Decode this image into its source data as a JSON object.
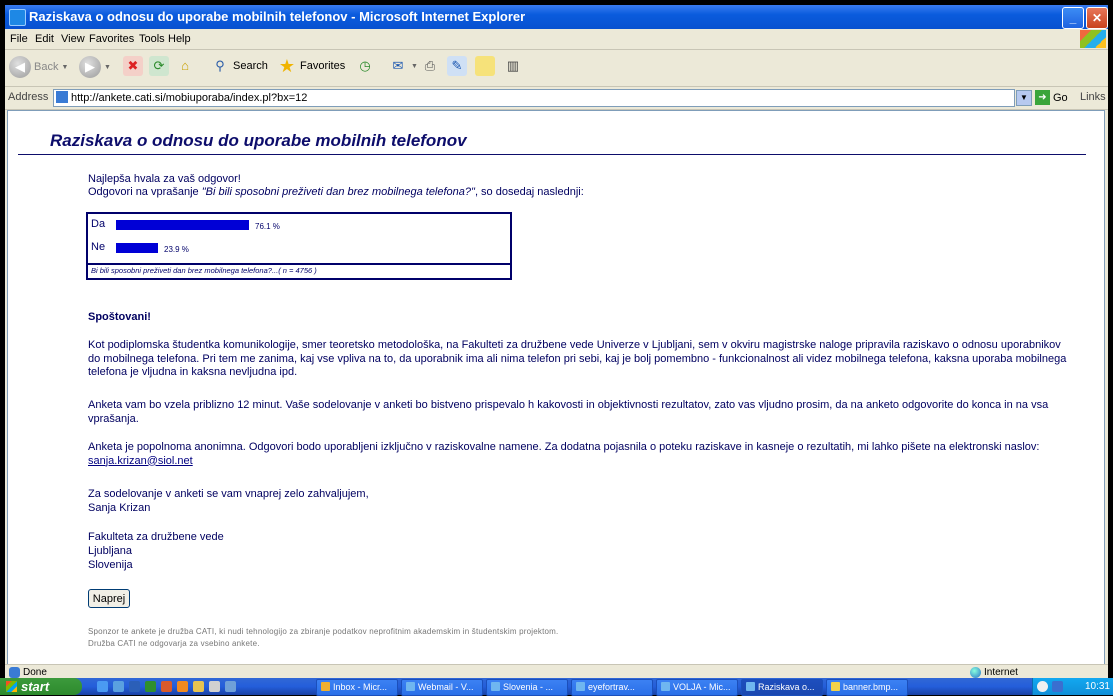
{
  "window": {
    "title": "Raziskava o odnosu do uporabe mobilnih telefonov - Microsoft Internet Explorer"
  },
  "menu": [
    "File",
    "Edit",
    "View",
    "Favorites",
    "Tools",
    "Help"
  ],
  "toolbar": {
    "back": "Back",
    "search": "Search",
    "favorites": "Favorites"
  },
  "address": {
    "label": "Address",
    "url": "http://ankete.cati.si/mobiuporaba/index.pl?bx=12",
    "go": "Go",
    "links": "Links"
  },
  "page": {
    "title": "Raziskava o odnosu do uporabe mobilnih telefonov",
    "thanks": "Najlepša hvala za vaš odgovor!",
    "answers_prefix": "Odgovori na vprašanje ",
    "question": "\"Bi bili sposobni preživeti dan brez mobilnega telefona?\"",
    "answers_suffix": ", so dosedaj naslednji:",
    "poll": [
      {
        "label": "Da",
        "value": 76.1,
        "pct_text": "76.1 %"
      },
      {
        "label": "Ne",
        "value": 23.9,
        "pct_text": "23.9 %"
      }
    ],
    "poll_footer": "Bi bili sposobni preživeti dan brez mobilnega telefona?...( n = 4756 )",
    "greeting": "Spoštovani!",
    "para1": "Kot podiplomska študentka komunikologije, smer teoretsko metodološka, na Fakulteti za družbene vede Univerze v Ljubljani, sem v okviru magistrske naloge pripravila raziskavo o odnosu uporabnikov do mobilnega telefona. Pri tem me zanima, kaj vse vpliva na to, da uporabnik ima ali nima telefon pri sebi, kaj je bolj pomembno - funkcionalnost ali videz mobilnega telefona, kaksna uporaba mobilnega telefona je vljudna in kaksna nevljudna ipd.",
    "para2": "Anketa vam bo vzela priblizno 12 minut. Vaše sodelovanje v anketi bo bistveno prispevalo h kakovosti in objektivnosti rezultatov, zato vas vljudno prosim, da na anketo odgovorite do konca in na vsa vprašanja.",
    "para3": "Anketa je popolnoma anonimna. Odgovori bodo uporabljeni izključno v raziskovalne namene. Za dodatna pojasnila o poteku raziskave in kasneje o rezultatih, mi lahko pišete na elektronski naslov: ",
    "email": "sanja.krizan@siol.net",
    "closing1": "Za sodelovanje v anketi se vam vnaprej zelo zahvaljujem,",
    "closing2": "Sanja Krizan",
    "addr1": "Fakulteta za družbene vede",
    "addr2": "Ljubljana",
    "addr3": "Slovenija",
    "button": "Naprej",
    "sponsor1": "Sponzor te ankete je družba CATI, ki nudi tehnologijo za zbiranje podatkov neprofitnim akademskim in študentskim projektom.",
    "sponsor2": "Družba CATI ne odgovarja za vsebino ankete."
  },
  "status": {
    "left": "Done",
    "zone": "Internet"
  },
  "taskbar": {
    "start": "start",
    "tasks": [
      "Inbox - Micr...",
      "Webmail - V...",
      "Slovenia - ...",
      "eyefortrav...",
      "VOLJA - Mic...",
      "Raziskava o...",
      "banner.bmp..."
    ],
    "clock": "10:31"
  }
}
